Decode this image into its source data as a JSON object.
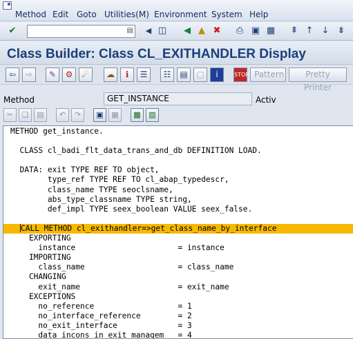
{
  "menu": {
    "items": [
      "Method",
      "Edit",
      "Goto",
      "Utilities(M)",
      "Environment",
      "System",
      "Help"
    ]
  },
  "standard_toolbar": {
    "command_field_value": "",
    "icons": [
      "enter-icon",
      "save-icon",
      "back-icon",
      "exit-icon",
      "cancel-icon",
      "print-icon",
      "find-icon",
      "find-next-icon",
      "first-page-icon",
      "previous-page-icon",
      "next-page-icon",
      "last-page-icon"
    ]
  },
  "title": "Class Builder: Class CL_EXITHANDLER Display",
  "app_toolbar": {
    "pattern_label": "Pattern",
    "pretty_printer_label": "Pretty Printer"
  },
  "method_row": {
    "label": "Method",
    "value": "GET_INSTANCE",
    "status": "Activ"
  },
  "editor": {
    "lines": [
      "METHOD get_instance.",
      "",
      "  CLASS cl_badi_flt_data_trans_and_db DEFINITION LOAD.",
      "",
      "  DATA: exit TYPE REF TO object,",
      "        type_ref TYPE REF TO cl_abap_typedescr,",
      "        class_name TYPE seoclsname,",
      "        abs_type_classname TYPE string,",
      "        def_impl TYPE seex_boolean VALUE seex_false.",
      "",
      "  CALL METHOD cl_exithandler=>get_class_name_by_interface",
      "    EXPORTING",
      "      instance                      = instance",
      "    IMPORTING",
      "      class_name                    = class_name",
      "    CHANGING",
      "      exit_name                     = exit_name",
      "    EXCEPTIONS",
      "      no_reference                  = 1",
      "      no_interface_reference        = 2",
      "      no_exit_interface             = 3",
      "      data_incons_in_exit_managem   = 4"
    ],
    "highlighted_line": 10
  },
  "colors": {
    "title_text": "#1b3f7a",
    "highlight": "#f7b800",
    "menu_text": "#102a5c"
  }
}
